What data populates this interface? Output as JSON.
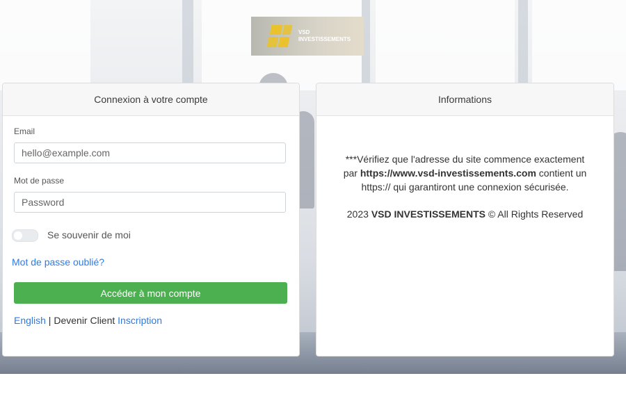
{
  "logo": {
    "text_line1": "VSD",
    "text_line2": "INVESTISSEMENTS"
  },
  "login": {
    "title": "Connexion à votre compte",
    "email_label": "Email",
    "email_placeholder": "hello@example.com",
    "password_label": "Mot de passe",
    "password_placeholder": "Password",
    "remember_label": "Se souvenir de moi",
    "remember_checked": false,
    "forgot_link": "Mot de passe oublié?",
    "submit_label": "Accéder à mon compte",
    "language_link": "English",
    "separator": " | ",
    "become_client": "Devenir Client ",
    "signup_link": "Inscription"
  },
  "info": {
    "title": "Informations",
    "notice_prefix": "***Vérifiez que l'adresse du site commence exactement par ",
    "notice_url": "https://www.vsd-investissements.com",
    "notice_suffix": " contient un https:// qui garantiront une connexion sécurisée.",
    "copyright_year": "2023 ",
    "copyright_company": "VSD INVESTISSEMENTS",
    "copyright_suffix": " © All Rights Reserved"
  },
  "colors": {
    "primary_button": "#4caf50",
    "link": "#2c7be5",
    "logo_accent": "#e9c22d"
  }
}
